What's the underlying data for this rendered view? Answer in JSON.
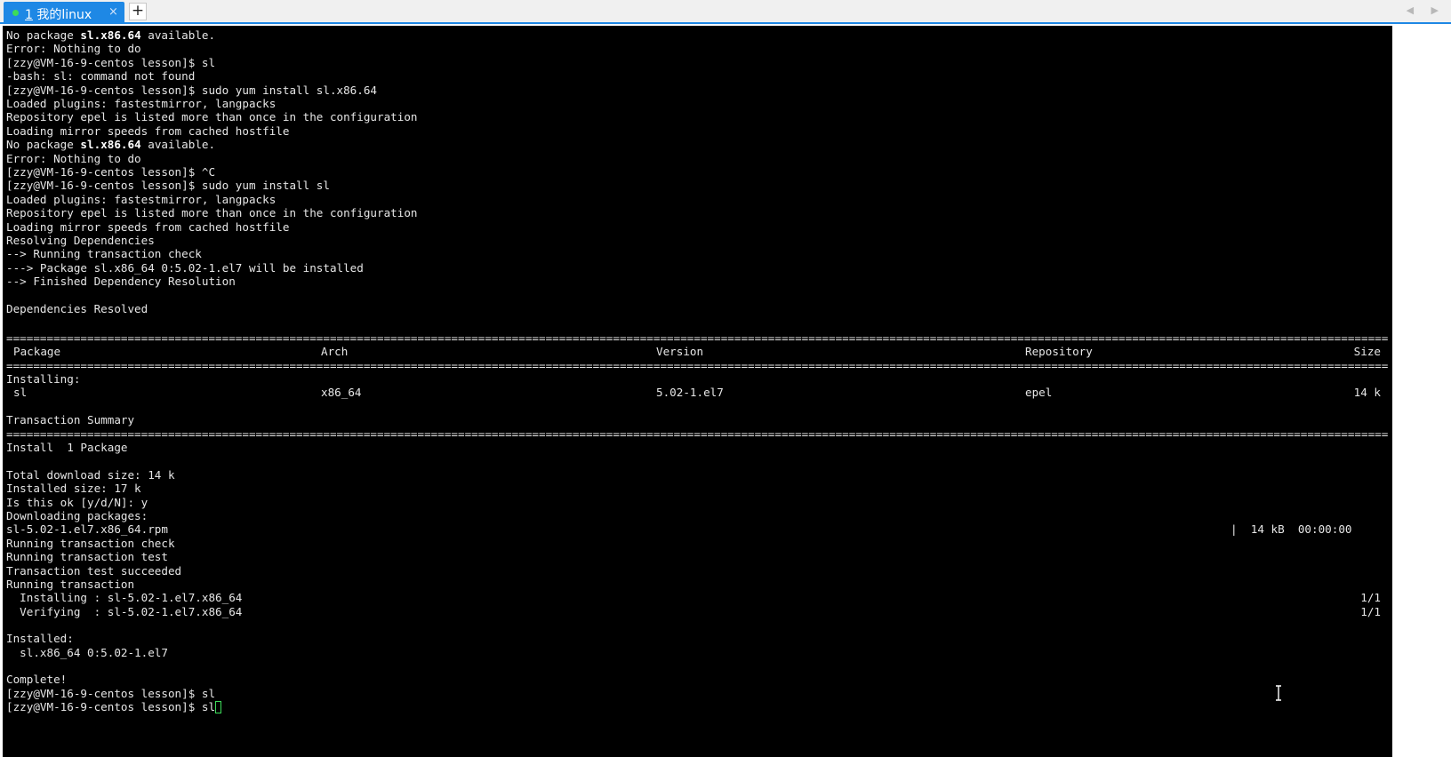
{
  "tabbar": {
    "tab_number": "1",
    "tab_title": "我的linux",
    "close_glyph": "×",
    "new_tab_glyph": "+",
    "nav_glyphs": "◀ ▶"
  },
  "colors": {
    "accent": "#1e88e5",
    "terminal_bg": "#000000",
    "terminal_fg": "#e6e6e6",
    "status_dot": "#3ddc5a",
    "cursor": "#3ddc5a"
  },
  "terminal": {
    "lines": [
      {
        "pre": "No package ",
        "bold": "sl.x86.64",
        "post": " available."
      },
      {
        "text": "Error: Nothing to do"
      },
      {
        "text": "[zzy@VM-16-9-centos lesson]$ sl"
      },
      {
        "text": "-bash: sl: command not found"
      },
      {
        "text": "[zzy@VM-16-9-centos lesson]$ sudo yum install sl.x86.64"
      },
      {
        "text": "Loaded plugins: fastestmirror, langpacks"
      },
      {
        "text": "Repository epel is listed more than once in the configuration"
      },
      {
        "text": "Loading mirror speeds from cached hostfile"
      },
      {
        "pre": "No package ",
        "bold": "sl.x86.64",
        "post": " available."
      },
      {
        "text": "Error: Nothing to do"
      },
      {
        "text": "[zzy@VM-16-9-centos lesson]$ ^C"
      },
      {
        "text": "[zzy@VM-16-9-centos lesson]$ sudo yum install sl"
      },
      {
        "text": "Loaded plugins: fastestmirror, langpacks"
      },
      {
        "text": "Repository epel is listed more than once in the configuration"
      },
      {
        "text": "Loading mirror speeds from cached hostfile"
      },
      {
        "text": "Resolving Dependencies"
      },
      {
        "text": "--> Running transaction check"
      },
      {
        "text": "---> Package sl.x86_64 0:5.02-1.el7 will be installed"
      },
      {
        "text": "--> Finished Dependency Resolution"
      },
      {
        "text": ""
      },
      {
        "text": "Dependencies Resolved"
      }
    ],
    "table": {
      "headers": [
        "Package",
        "Arch",
        "Version",
        "Repository",
        "Size"
      ],
      "section": "Installing:",
      "row": [
        "sl",
        "x86_64",
        "5.02-1.el7",
        "epel",
        "14 k"
      ],
      "summary_title": "Transaction Summary",
      "summary_line": "Install  1 Package"
    },
    "download": {
      "total_size": "Total download size: 14 k",
      "installed_size": "Installed size: 17 k",
      "confirm": "Is this ok [y/d/N]: y",
      "downloading": "Downloading packages:",
      "rpm": "sl-5.02-1.el7.x86_64.rpm",
      "progress": "|  14 kB  00:00:00"
    },
    "tail": [
      "Running transaction check",
      "Running transaction test",
      "Transaction test succeeded",
      "Running transaction"
    ],
    "steps": [
      {
        "text": "  Installing : sl-5.02-1.el7.x86_64",
        "count": "1/1"
      },
      {
        "text": "  Verifying  : sl-5.02-1.el7.x86_64",
        "count": "1/1"
      }
    ],
    "installed_title": "Installed:",
    "installed_pkg": "  sl.x86_64 0:5.02-1.el7",
    "complete": "Complete!",
    "prompt_1": "[zzy@VM-16-9-centos lesson]$ sl",
    "prompt_2": "[zzy@VM-16-9-centos lesson]$ sl"
  }
}
